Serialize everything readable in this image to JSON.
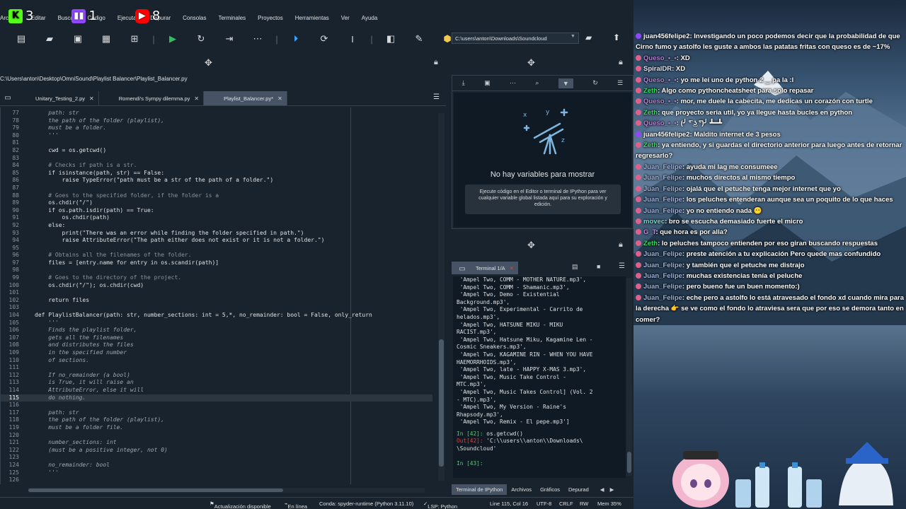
{
  "overlay": {
    "kick_count": "3",
    "twitch_count": "1",
    "youtube_count": "8",
    "colors": {
      "kick": "#53fc18",
      "twitch": "#9146ff",
      "youtube": "#ff0000"
    }
  },
  "menubar": {
    "items": [
      "Archivo",
      "Editar",
      "Buscar",
      "Código",
      "Ejecutar",
      "Depurar",
      "Consolas",
      "Terminales",
      "Proyectos",
      "Herramientas",
      "Ver",
      "Ayuda"
    ]
  },
  "toolbar": {
    "path_value": "C:\\users\\anton\\Downloads\\Soundcloud"
  },
  "editor": {
    "file_path": "C:\\Users\\anton\\Desktop\\OmniSound\\Playlist Balancer\\Playlist_Balancer.py",
    "tabs": [
      {
        "label": "Unitary_Testing_2.py"
      },
      {
        "label": "Romendi's Sympy dilemma.py"
      },
      {
        "label": "Playlist_Balancer.py*"
      }
    ],
    "lines": [
      {
        "n": "77",
        "t": "    path: str",
        "k": "doc"
      },
      {
        "n": "78",
        "t": "    the path of the folder (playlist),",
        "k": "doc"
      },
      {
        "n": "79",
        "t": "    must be a folder.",
        "k": "doc"
      },
      {
        "n": "80",
        "t": "    '''",
        "k": "doc"
      },
      {
        "n": "81",
        "t": "",
        "k": ""
      },
      {
        "n": "82",
        "t": "    cwd = os.getcwd()",
        "k": ""
      },
      {
        "n": "83",
        "t": "",
        "k": ""
      },
      {
        "n": "84",
        "t": "    # Checks if path is a str.",
        "k": "comment"
      },
      {
        "n": "85",
        "t": "    if isinstance(path, str) == False:",
        "k": ""
      },
      {
        "n": "86",
        "t": "        raise TypeError(\"path must be a str of the path of a folder.\")",
        "k": ""
      },
      {
        "n": "87",
        "t": "",
        "k": ""
      },
      {
        "n": "88",
        "t": "    # Goes to the specified folder, if the folder is a",
        "k": "comment"
      },
      {
        "n": "89",
        "t": "    os.chdir(\"/\")",
        "k": ""
      },
      {
        "n": "90",
        "t": "    if os.path.isdir(path) == True:",
        "k": ""
      },
      {
        "n": "91",
        "t": "        os.chdir(path)",
        "k": ""
      },
      {
        "n": "92",
        "t": "    else:",
        "k": ""
      },
      {
        "n": "93",
        "t": "        print(\"There was an error while finding the folder specified in path.\")",
        "k": ""
      },
      {
        "n": "94",
        "t": "        raise AttributeError(\"The path either does not exist or it is not a folder.\")",
        "k": ""
      },
      {
        "n": "95",
        "t": "",
        "k": ""
      },
      {
        "n": "96",
        "t": "    # Obtains all the filenames of the folder.",
        "k": "comment"
      },
      {
        "n": "97",
        "t": "    files = [entry.name for entry in os.scandir(path)]",
        "k": ""
      },
      {
        "n": "98",
        "t": "",
        "k": ""
      },
      {
        "n": "99",
        "t": "    # Goes to the directory of the project.",
        "k": "comment"
      },
      {
        "n": "100",
        "t": "    os.chdir(\"/\"); os.chdir(cwd)",
        "k": ""
      },
      {
        "n": "101",
        "t": "",
        "k": ""
      },
      {
        "n": "102",
        "t": "    return files",
        "k": ""
      },
      {
        "n": "103",
        "t": "",
        "k": ""
      },
      {
        "n": "104",
        "t": "def PlaylistBalancer(path: str, number_sections: int = 5,*, no_remainder: bool = False, only_return",
        "k": ""
      },
      {
        "n": "105",
        "t": "    '''",
        "k": "doc"
      },
      {
        "n": "106",
        "t": "    Finds the playlist folder,",
        "k": "doc"
      },
      {
        "n": "107",
        "t": "    gets all the filenames",
        "k": "doc"
      },
      {
        "n": "108",
        "t": "    and distributes the files",
        "k": "doc"
      },
      {
        "n": "109",
        "t": "    in the specified number",
        "k": "doc"
      },
      {
        "n": "110",
        "t": "    of sections.",
        "k": "doc"
      },
      {
        "n": "111",
        "t": "",
        "k": "doc"
      },
      {
        "n": "112",
        "t": "    If no_remainder (a bool)",
        "k": "doc"
      },
      {
        "n": "113",
        "t": "    is True, it will raise an",
        "k": "doc"
      },
      {
        "n": "114",
        "t": "    AttributeError, else it will",
        "k": "doc"
      },
      {
        "n": "115",
        "t": "    do nothing.",
        "k": "doc current"
      },
      {
        "n": "116",
        "t": "",
        "k": "doc"
      },
      {
        "n": "117",
        "t": "    path: str",
        "k": "doc"
      },
      {
        "n": "118",
        "t": "    the path of the folder (playlist),",
        "k": "doc"
      },
      {
        "n": "119",
        "t": "    must be a folder file.",
        "k": "doc"
      },
      {
        "n": "120",
        "t": "",
        "k": "doc"
      },
      {
        "n": "121",
        "t": "    number_sections: int",
        "k": "doc"
      },
      {
        "n": "122",
        "t": "    (must be a positive integer, not 0)",
        "k": "doc"
      },
      {
        "n": "123",
        "t": "",
        "k": "doc"
      },
      {
        "n": "124",
        "t": "    no_remainder: bool",
        "k": "doc"
      },
      {
        "n": "125",
        "t": "    '''",
        "k": "doc"
      },
      {
        "n": "126",
        "t": "",
        "k": ""
      }
    ]
  },
  "variable_explorer": {
    "empty_title": "No hay variables para mostrar",
    "hint": "Ejecute código en el Editor o terminal de IPython para ver cualquier variable global listada aquí para su exploración y edición."
  },
  "console": {
    "tab_label": "Terminal 1/A",
    "output_lines": [
      " 'Ampel Two, COMM - MOTHER NATURE.mp3',",
      " 'Ampel Two, COMM - Shamanic.mp3',",
      " 'Ampel Two, Demo - Existential",
      "Background.mp3',",
      " 'Ampel Two, Experimental - Carrito de",
      "helados.mp3',",
      " 'Ampel Two, HATSUNE MIKU - MIKU",
      "RACIST.mp3',",
      " 'Ampel Two, Hatsune Miku, Kagamine Len -",
      "Cosmic Sneakers.mp3',",
      " 'Ampel Two, KAGAMINE RIN - WHEN YOU HAVE",
      "HAEMORRHOIDS.mp3',",
      " 'Ampel Two, late - HAPPY X-MAS 3.mp3',",
      " 'Ampel Two, Music Take Control -",
      "MTC.mp3',",
      " 'Ampel Two, Music Takes Control] (Vol. 2",
      "- MTC).mp3',",
      " 'Ampel Two, My Version - Raine's",
      "Rhapsody.mp3',",
      " 'Ampel Two, Remix - El pepe.mp3']"
    ],
    "in42_label": "In [42]:",
    "in42_code": " os.getcwd()",
    "out42_label": "Out[42]:",
    "out42_value": " 'C:\\\\users\\\\anton\\\\Downloads\\",
    "out42_value2": "\\Soundcloud'",
    "in43_label": "In [43]:",
    "bottom_tabs": [
      "Terminal de IPython",
      "Archivos",
      "Gráficos",
      "Depurad"
    ]
  },
  "statusbar": {
    "update": "Actualización disponible",
    "online": "En línea",
    "conda": "Conda: spyder-runtime (Python 3.11.10)",
    "lsp": "LSP: Python",
    "position": "Line 115, Col 16",
    "encoding": "UTF-8",
    "eol": "CRLF",
    "perm": "RW",
    "mem": "Mem 35%"
  },
  "chat": {
    "messages": [
      {
        "user": "juan456felipe2",
        "cls": "u-juan4",
        "badge": "#9146ff",
        "text": ": Investigando un poco podemos decir que la probabilidad de que Cirno fumo y astolfo les guste a ambos las patatas fritas con queso es de ~17%"
      },
      {
        "user": "Queso_•_•",
        "cls": "u-queso",
        "badge": "#e0608a",
        "text": ": XD"
      },
      {
        "user": "SpiralDR",
        "cls": "u-spiral",
        "badge": "#e0608a",
        "text": ": XD"
      },
      {
        "user": "Queso_•_•",
        "cls": "u-queso",
        "badge": "#e0608a",
        "text": ": yo me leí uno de python 2 ‿ pa la :l"
      },
      {
        "user": "Zeth",
        "cls": "u-zeth",
        "badge": "#e0608a",
        "text": ": Algo como pythoncheatsheet para solo repasar"
      },
      {
        "user": "Queso_•_•",
        "cls": "u-queso",
        "badge": "#e0608a",
        "text": ": mor, me duele la cabecita, me dedicas un corazón con turtle"
      },
      {
        "user": "Zeth",
        "cls": "u-zeth",
        "badge": "#e0608a",
        "text": ": que proyecto seria util, yo ya llegue hasta bucles en python"
      },
      {
        "user": "Queso_•_•",
        "cls": "u-queso",
        "badge": "#e0608a",
        "text": ": (╯ ͡° ͜ʖ ͡°)╯ ┻━┻"
      },
      {
        "user": "juan456felipe2",
        "cls": "u-juan4",
        "badge": "#9146ff",
        "text": ": Maldito internet de 3 pesos"
      },
      {
        "user": "Zeth",
        "cls": "u-zeth",
        "badge": "#e0608a",
        "text": ": ya entiendo, y si guardas el directorio anterior para luego antes de retornar regresarlo?"
      },
      {
        "user": "Juan_Felipe",
        "cls": "u-juanf",
        "badge": "#e0608a",
        "text": ": ayuda mi lag me consumeee"
      },
      {
        "user": "Juan_Felipe",
        "cls": "u-juanf",
        "badge": "#e0608a",
        "text": ": muchos directos al mismo tiempo"
      },
      {
        "user": "Juan_Felipe",
        "cls": "u-juanf",
        "badge": "#e0608a",
        "text": ": ojalá que el petuche tenga mejor internet que yo"
      },
      {
        "user": "Juan_Felipe",
        "cls": "u-juanf",
        "badge": "#e0608a",
        "text": ": los peluches entenderan aunque sea un poquito de lo que haces"
      },
      {
        "user": "Juan_Felipe",
        "cls": "u-juanf",
        "badge": "#e0608a",
        "text": ": yo no entiendo nada 😶"
      },
      {
        "user": "movec",
        "cls": "u-movec",
        "badge": "#e0608a",
        "text": ": bro se escucha demasiado fuerte el micro"
      },
      {
        "user": "G_T",
        "cls": "u-gt",
        "badge": "#e0608a",
        "text": ": que hora es por alla?"
      },
      {
        "user": "Zeth",
        "cls": "u-zeth",
        "badge": "#e0608a",
        "text": ": lo peluches tampoco entienden por eso giran buscando respuestas"
      },
      {
        "user": "Juan_Felipe",
        "cls": "u-juanf",
        "badge": "#e0608a",
        "text": ": preste atención a tu explicación Pero quede mas confundido"
      },
      {
        "user": "Juan_Felipe",
        "cls": "u-juanf",
        "badge": "#e0608a",
        "text": ": y también que el petuche me distrajo"
      },
      {
        "user": "Juan_Felipe",
        "cls": "u-juanf",
        "badge": "#e0608a",
        "text": ": muchas existencias tenía el peluche"
      },
      {
        "user": "Juan_Felipe",
        "cls": "u-juanf",
        "badge": "#e0608a",
        "text": ": pero bueno fue un buen momento:)"
      },
      {
        "user": "Juan_Felipe",
        "cls": "u-juanf",
        "badge": "#e0608a",
        "text": ": eche pero a astolfo lo está atravesado el fondo xd cuando mira para la derecha 👉 se ve como el fondo lo atraviesa sera que por eso se demora tanto en comer?"
      }
    ]
  }
}
